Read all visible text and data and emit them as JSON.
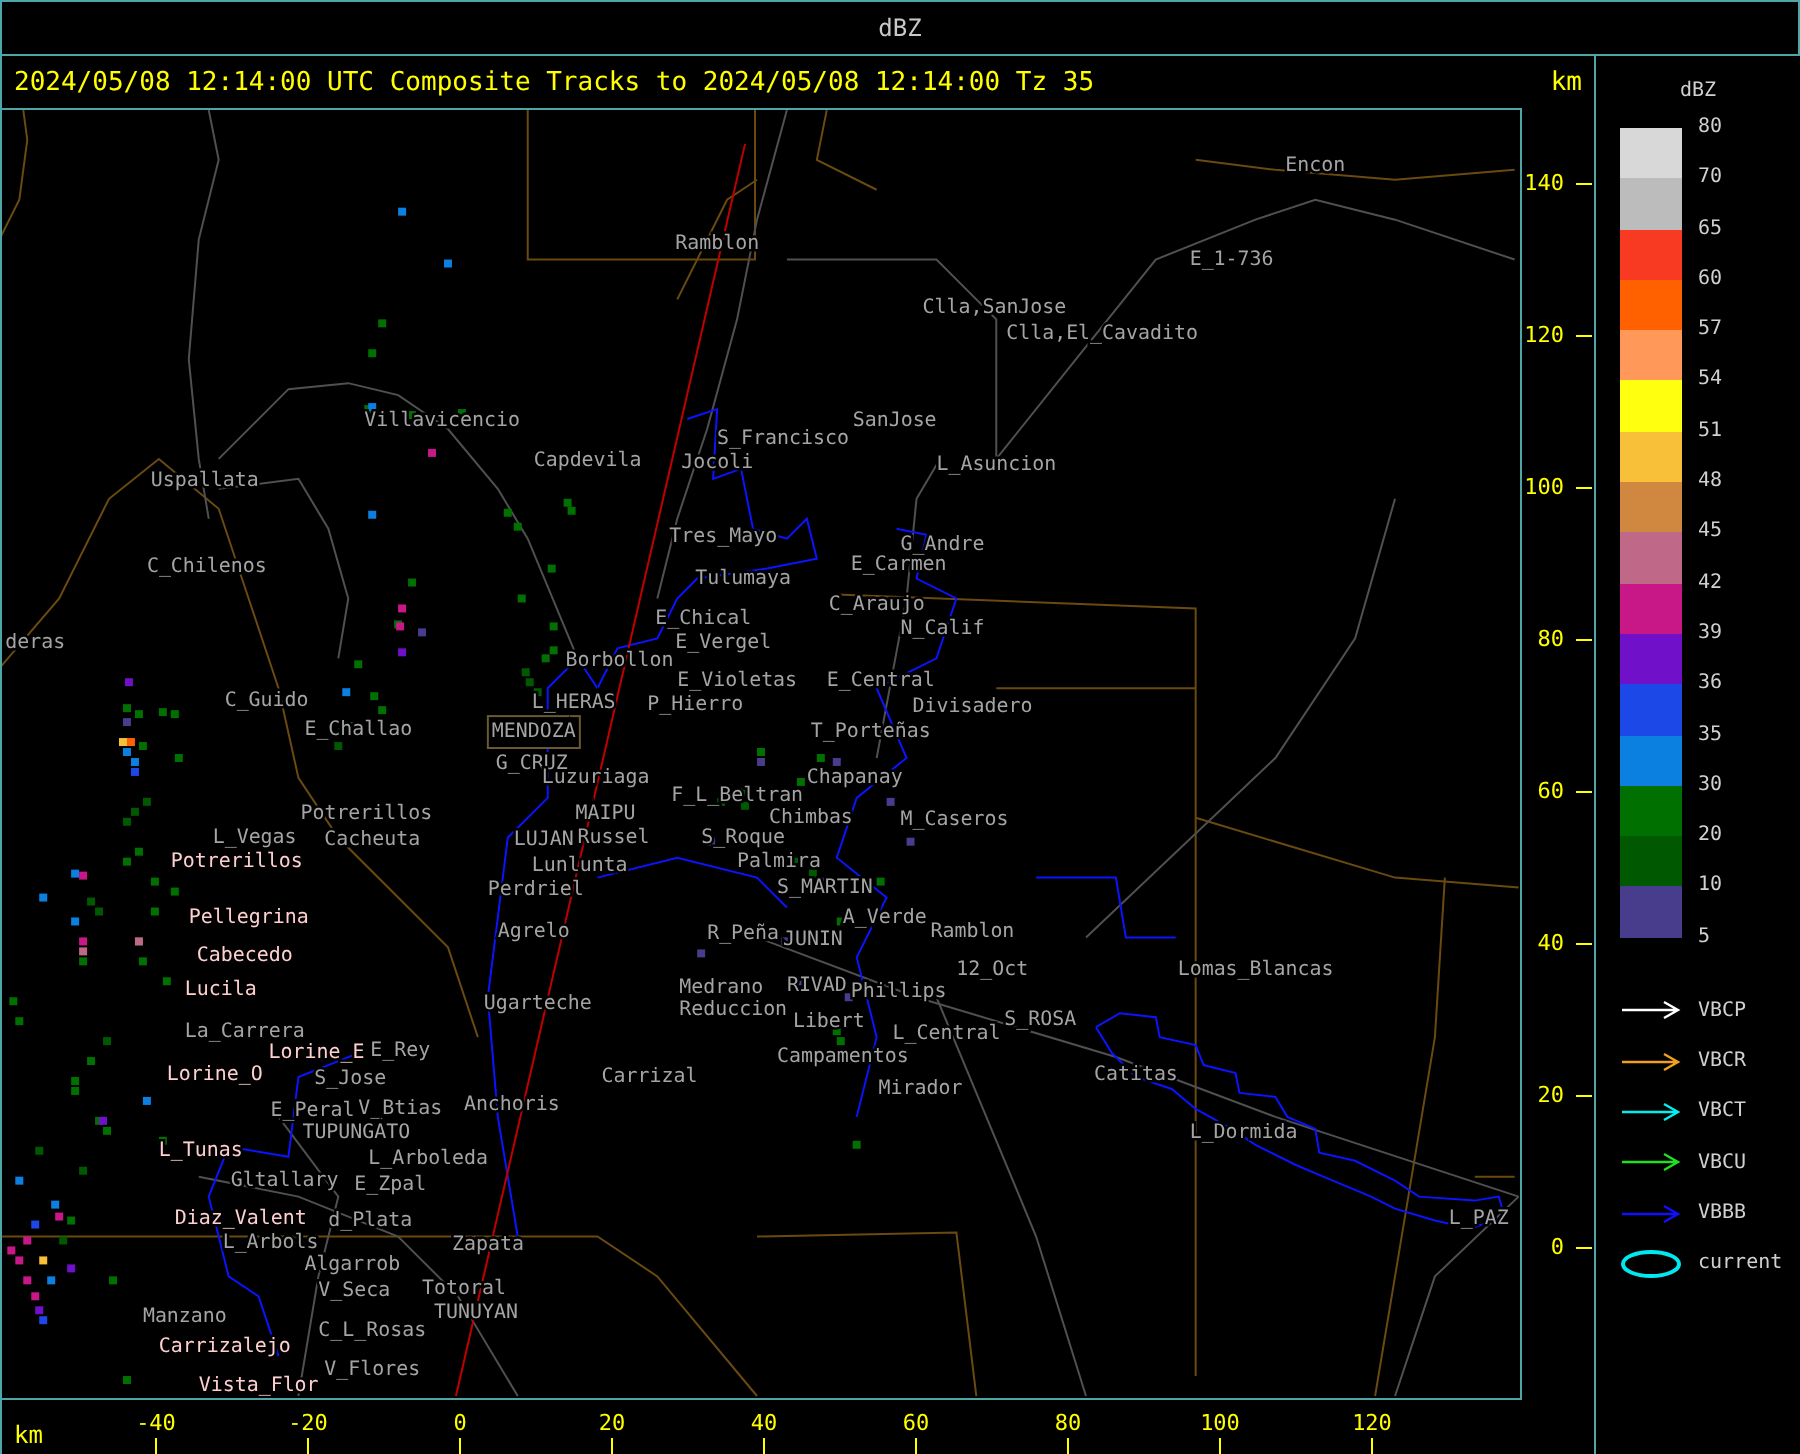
{
  "header": {
    "title": "dBZ"
  },
  "plot": {
    "title": "2024/05/08 12:14:00 UTC Composite Tracks to 2024/05/08 12:14:00 Tz 35",
    "y_unit": "km",
    "x_unit": "km",
    "x_ticks": [
      "-40",
      "-20",
      "0",
      "20",
      "40",
      "60",
      "80",
      "100",
      "120"
    ],
    "y_ticks": [
      "140",
      "120",
      "100",
      "80",
      "60",
      "40",
      "20",
      "0"
    ],
    "places": [
      {
        "name": "Encon",
        "kind": "town"
      },
      {
        "name": "Ramblon",
        "kind": "town"
      },
      {
        "name": "E_1-736",
        "kind": "town"
      },
      {
        "name": "Clla,SanJose",
        "kind": "town"
      },
      {
        "name": "Clla,El_Cavadito",
        "kind": "town"
      },
      {
        "name": "Villavicencio",
        "kind": "town"
      },
      {
        "name": "SanJose",
        "kind": "town"
      },
      {
        "name": "S_Francisco",
        "kind": "town"
      },
      {
        "name": "Capdevila",
        "kind": "town"
      },
      {
        "name": "Jocoli",
        "kind": "town"
      },
      {
        "name": "L_Asuncion",
        "kind": "town"
      },
      {
        "name": "Uspallata",
        "kind": "town"
      },
      {
        "name": "Tres_Mayo",
        "kind": "town"
      },
      {
        "name": "G_Andre",
        "kind": "town"
      },
      {
        "name": "C_Chilenos",
        "kind": "town"
      },
      {
        "name": "E_Carmen",
        "kind": "town"
      },
      {
        "name": "Tulumaya",
        "kind": "town"
      },
      {
        "name": "C_Araujo",
        "kind": "town"
      },
      {
        "name": "E_Chical",
        "kind": "town"
      },
      {
        "name": "N_Calif",
        "kind": "town"
      },
      {
        "name": "deras",
        "kind": "town"
      },
      {
        "name": "E_Vergel",
        "kind": "town"
      },
      {
        "name": "Borbollon",
        "kind": "town"
      },
      {
        "name": "E_Violetas",
        "kind": "town"
      },
      {
        "name": "E_Central",
        "kind": "town"
      },
      {
        "name": "C_Guido",
        "kind": "town"
      },
      {
        "name": "L_HERAS",
        "kind": "town"
      },
      {
        "name": "P_Hierro",
        "kind": "town"
      },
      {
        "name": "Divisadero",
        "kind": "town"
      },
      {
        "name": "E_Challao",
        "kind": "town"
      },
      {
        "name": "MENDOZA",
        "kind": "capital"
      },
      {
        "name": "T_Porteñas",
        "kind": "town"
      },
      {
        "name": "G_CRUZ",
        "kind": "town"
      },
      {
        "name": "Luzuriaga",
        "kind": "town"
      },
      {
        "name": "Chapanay",
        "kind": "town"
      },
      {
        "name": "F_L_Beltran",
        "kind": "town"
      },
      {
        "name": "Potrerillos",
        "kind": "town"
      },
      {
        "name": "MAIPU",
        "kind": "town"
      },
      {
        "name": "Chimbas",
        "kind": "town"
      },
      {
        "name": "M_Caseros",
        "kind": "town"
      },
      {
        "name": "L_Vegas",
        "kind": "town"
      },
      {
        "name": "Cacheuta",
        "kind": "town"
      },
      {
        "name": "LUJAN",
        "kind": "town"
      },
      {
        "name": "Russel",
        "kind": "town"
      },
      {
        "name": "S_Roque",
        "kind": "town"
      },
      {
        "name": "Potrerillos",
        "kind": "station"
      },
      {
        "name": "Lunlunta",
        "kind": "town"
      },
      {
        "name": "Palmira",
        "kind": "town"
      },
      {
        "name": "Perdriel",
        "kind": "town"
      },
      {
        "name": "S_MARTIN",
        "kind": "town"
      },
      {
        "name": "Pellegrina",
        "kind": "station"
      },
      {
        "name": "A_Verde",
        "kind": "town"
      },
      {
        "name": "Agrelo",
        "kind": "town"
      },
      {
        "name": "R_Peña",
        "kind": "town"
      },
      {
        "name": "JUNIN",
        "kind": "town"
      },
      {
        "name": "Ramblon",
        "kind": "town"
      },
      {
        "name": "Cabecedo",
        "kind": "station"
      },
      {
        "name": "12_Oct",
        "kind": "town"
      },
      {
        "name": "Lomas_Blancas",
        "kind": "town"
      },
      {
        "name": "Lucila",
        "kind": "station"
      },
      {
        "name": "Medrano",
        "kind": "town"
      },
      {
        "name": "RIVAD",
        "kind": "town"
      },
      {
        "name": "Phillips",
        "kind": "town"
      },
      {
        "name": "Ugarteche",
        "kind": "town"
      },
      {
        "name": "Reduccion",
        "kind": "town"
      },
      {
        "name": "Libert",
        "kind": "town"
      },
      {
        "name": "S_ROSA",
        "kind": "town"
      },
      {
        "name": "La_Carrera",
        "kind": "town"
      },
      {
        "name": "L_Central",
        "kind": "town"
      },
      {
        "name": "Lorine_E",
        "kind": "station"
      },
      {
        "name": "E_Rey",
        "kind": "town"
      },
      {
        "name": "Campamentos",
        "kind": "town"
      },
      {
        "name": "Lorine_O",
        "kind": "station"
      },
      {
        "name": "S_Jose",
        "kind": "town"
      },
      {
        "name": "Carrizal",
        "kind": "town"
      },
      {
        "name": "Catitas",
        "kind": "town"
      },
      {
        "name": "Mirador",
        "kind": "town"
      },
      {
        "name": "E_Peral",
        "kind": "town"
      },
      {
        "name": "V_Btias",
        "kind": "town"
      },
      {
        "name": "Anchoris",
        "kind": "town"
      },
      {
        "name": "TUPUNGATO",
        "kind": "town"
      },
      {
        "name": "L_Dormida",
        "kind": "town"
      },
      {
        "name": "L_Tunas",
        "kind": "station"
      },
      {
        "name": "L_Arboleda",
        "kind": "town"
      },
      {
        "name": "Gltallary",
        "kind": "town"
      },
      {
        "name": "E_Zpal",
        "kind": "town"
      },
      {
        "name": "Diaz_Valent",
        "kind": "station"
      },
      {
        "name": "d_Plata",
        "kind": "town"
      },
      {
        "name": "L_PAZ",
        "kind": "town"
      },
      {
        "name": "L_Arbols",
        "kind": "town"
      },
      {
        "name": "Zapata",
        "kind": "town"
      },
      {
        "name": "Algarrob",
        "kind": "town"
      },
      {
        "name": "V_Seca",
        "kind": "town"
      },
      {
        "name": "Totoral",
        "kind": "town"
      },
      {
        "name": "Manzano",
        "kind": "town"
      },
      {
        "name": "TUNUYAN",
        "kind": "town"
      },
      {
        "name": "C_L_Rosas",
        "kind": "town"
      },
      {
        "name": "Carrizalejo",
        "kind": "station"
      },
      {
        "name": "V_Flores",
        "kind": "town"
      },
      {
        "name": "Vista_Flor",
        "kind": "station"
      }
    ]
  },
  "legend": {
    "title": "dBZ",
    "scale": [
      {
        "label": "80",
        "color": "#d8d8d8"
      },
      {
        "label": "70",
        "color": "#bcbcbc"
      },
      {
        "label": "65",
        "color": "#f83a22"
      },
      {
        "label": "60",
        "color": "#ff6000"
      },
      {
        "label": "57",
        "color": "#ff9858"
      },
      {
        "label": "54",
        "color": "#ffff10"
      },
      {
        "label": "51",
        "color": "#f8c038"
      },
      {
        "label": "48",
        "color": "#d08840"
      },
      {
        "label": "45",
        "color": "#c06888"
      },
      {
        "label": "42",
        "color": "#c81888"
      },
      {
        "label": "39",
        "color": "#7010c8"
      },
      {
        "label": "36",
        "color": "#1c48e8"
      },
      {
        "label": "35",
        "color": "#0c80e0"
      },
      {
        "label": "30",
        "color": "#007000"
      },
      {
        "label": "20",
        "color": "#005800"
      },
      {
        "label": "10",
        "color": "#483c8c"
      },
      {
        "label": "5"
      }
    ],
    "tracks": [
      {
        "label": "VBCP",
        "kind": "arrow",
        "color": "#ffffff"
      },
      {
        "label": "VBCR",
        "kind": "arrow",
        "color": "#f0a020"
      },
      {
        "label": "VBCT",
        "kind": "arrow",
        "color": "#00f0f0"
      },
      {
        "label": "VBCU",
        "kind": "arrow",
        "color": "#20e020"
      },
      {
        "label": "VBBB",
        "kind": "arrow",
        "color": "#1010ff"
      },
      {
        "label": "current",
        "kind": "ellipse",
        "color": "#00e8f0"
      }
    ]
  }
}
